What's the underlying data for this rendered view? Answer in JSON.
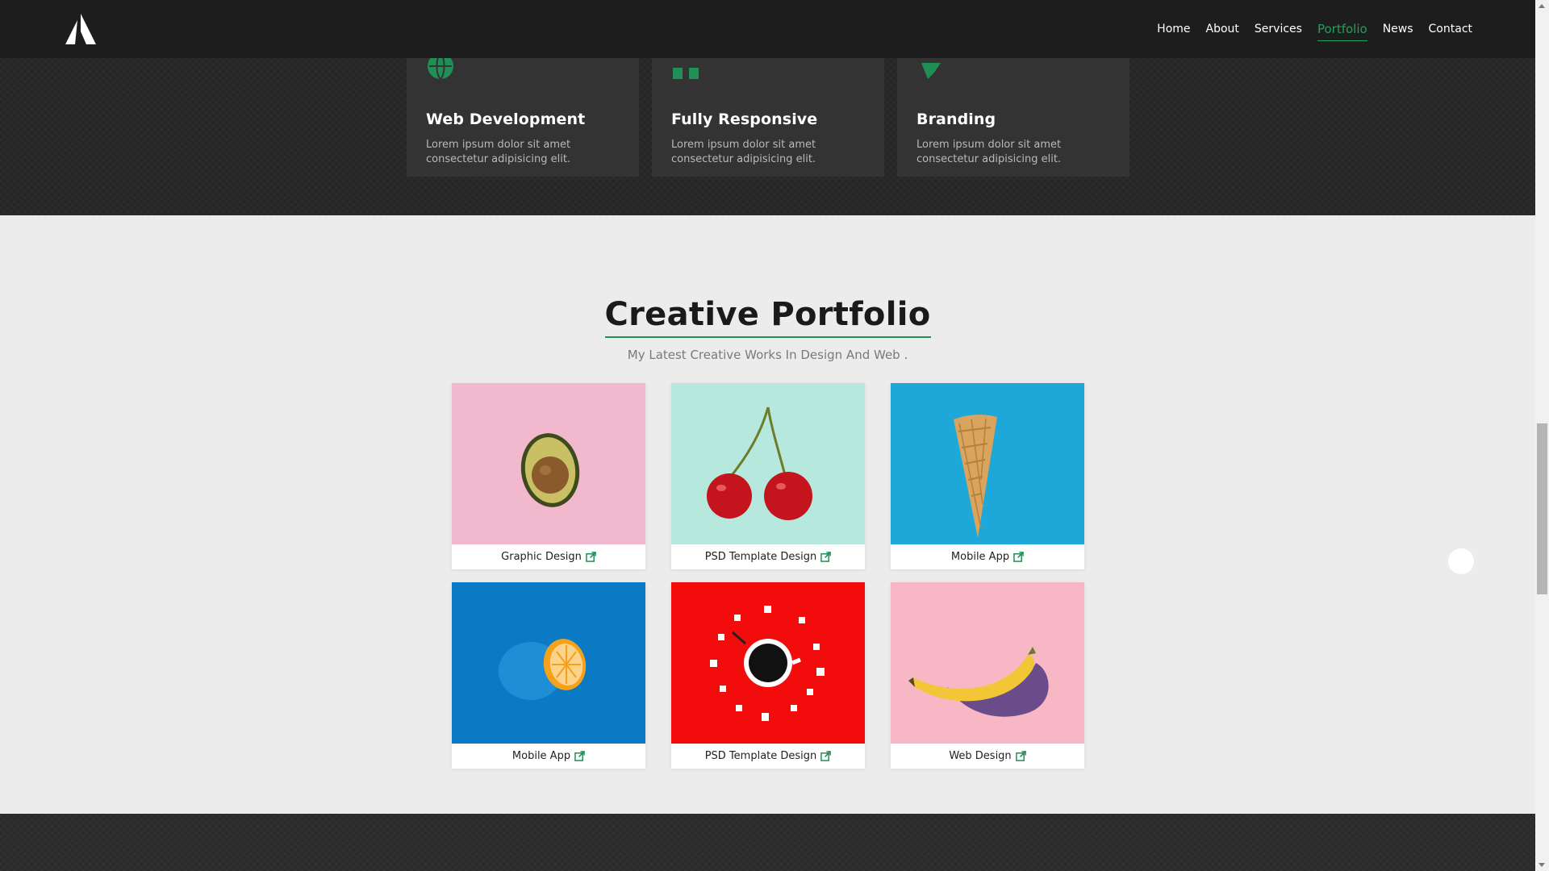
{
  "colors": {
    "accent": "#1fa25a",
    "header_bg": "#1d1d1d",
    "section_bg": "#ececec"
  },
  "header": {
    "logo_icon": "triangle-logo",
    "nav": [
      {
        "label": "Home",
        "active": false
      },
      {
        "label": "About",
        "active": false
      },
      {
        "label": "Services",
        "active": false
      },
      {
        "label": "Portfolio",
        "active": true
      },
      {
        "label": "News",
        "active": false
      },
      {
        "label": "Contact",
        "active": false
      }
    ]
  },
  "services": [
    {
      "icon": "globe-icon",
      "title": "Web Development",
      "text": "Lorem ipsum dolor sit amet consectetur adipisicing elit."
    },
    {
      "icon": "responsive-icon",
      "title": "Fully Responsive",
      "text": "Lorem ipsum dolor sit amet consectetur adipisicing elit."
    },
    {
      "icon": "brand-icon",
      "title": "Branding",
      "text": "Lorem ipsum dolor sit amet consectetur adipisicing elit."
    }
  ],
  "portfolio": {
    "title": "Creative Portfolio",
    "subtitle": "My Latest Creative Works In Design And Web .",
    "items": [
      {
        "label": "Graphic Design",
        "image": "avocado-on-pink"
      },
      {
        "label": "PSD Template Design",
        "image": "cherries-on-mint"
      },
      {
        "label": "Mobile App",
        "image": "ice-cream-cone-on-blue"
      },
      {
        "label": "Mobile App",
        "image": "orange-on-blue"
      },
      {
        "label": "PSD Template Design",
        "image": "coffee-cup-on-red"
      },
      {
        "label": "Web Design",
        "image": "banana-on-pink"
      }
    ]
  }
}
